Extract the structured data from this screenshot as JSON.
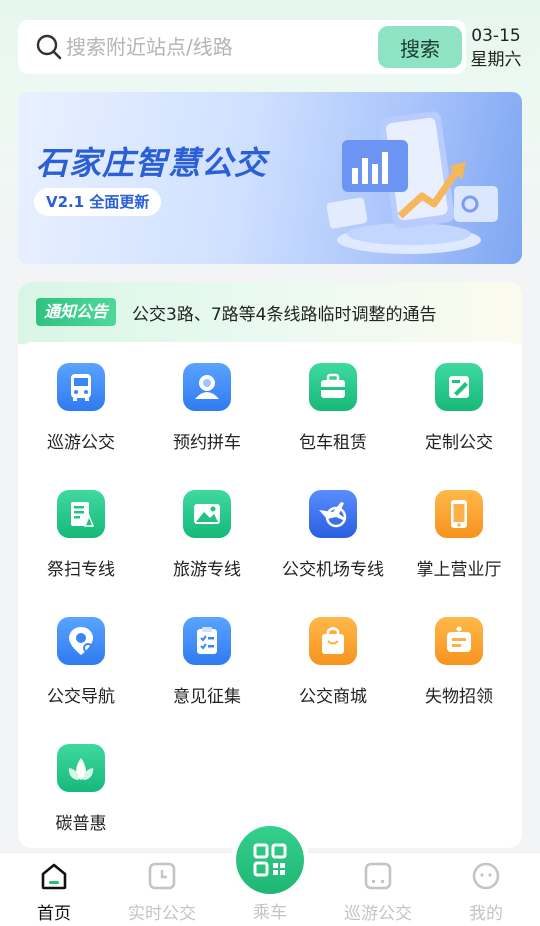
{
  "search": {
    "placeholder": "搜索附近站点/线路",
    "button_label": "搜索"
  },
  "date": {
    "day": "03-15",
    "weekday": "星期六"
  },
  "banner": {
    "title": "石家庄智慧公交",
    "version": "V2.1 全面更新"
  },
  "notice": {
    "tag": "通知公告",
    "text": "公交3路、7路等4条线路临时调整的通告"
  },
  "services": [
    {
      "label": "巡游公交",
      "icon": "bus-icon"
    },
    {
      "label": "预约拼车",
      "icon": "carpool-icon"
    },
    {
      "label": "包车租赁",
      "icon": "briefcase-icon"
    },
    {
      "label": "定制公交",
      "icon": "edit-icon"
    },
    {
      "label": "祭扫专线",
      "icon": "memorial-icon"
    },
    {
      "label": "旅游专线",
      "icon": "landscape-icon"
    },
    {
      "label": "公交机场专线",
      "icon": "airplane-icon"
    },
    {
      "label": "掌上营业厅",
      "icon": "phone-icon"
    },
    {
      "label": "公交导航",
      "icon": "navigation-icon"
    },
    {
      "label": "意见征集",
      "icon": "clipboard-icon"
    },
    {
      "label": "公交商城",
      "icon": "shopping-bag-icon"
    },
    {
      "label": "失物招领",
      "icon": "lost-found-icon"
    },
    {
      "label": "碳普惠",
      "icon": "leaf-icon"
    }
  ],
  "nav": {
    "home": "首页",
    "realtime": "实时公交",
    "ride": "乘车",
    "cruise": "巡游公交",
    "mine": "我的"
  },
  "colors": {
    "accent_green": "#22c07a",
    "search_button": "#8ee3c4",
    "banner_blue": "#2a5fd6",
    "icon_blue": "#3a86f5",
    "icon_green": "#20c286",
    "icon_orange": "#fb9a2a"
  }
}
